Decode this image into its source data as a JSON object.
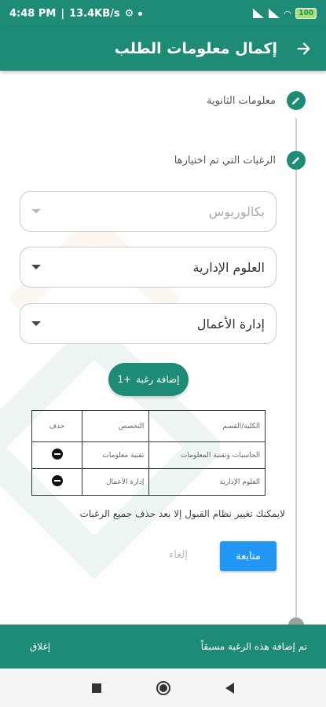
{
  "status_bar": {
    "time": "4:48 PM",
    "speed": "13.4KB/s",
    "battery": "100"
  },
  "app_bar": {
    "title": "إكمال معلومات الطلب",
    "back_icon": "arrow-right-icon"
  },
  "steps": [
    {
      "label": "معلومات الثانوية",
      "icon": "pencil-icon"
    },
    {
      "label": "الرغبات التي تم اختيارها",
      "icon": "pencil-icon"
    }
  ],
  "form": {
    "degree": "بكالوريوس",
    "college": "العلوم الإدارية",
    "major": "إدارة الأعمال",
    "add_button": "إضافة رغبة",
    "add_icon": "+1"
  },
  "table": {
    "headers": [
      "الكلية/القسم",
      "التخصص",
      "حذف"
    ],
    "rows": [
      {
        "college": "الحاسبات وتقنية المعلومات",
        "major": "تقنية معلومات"
      },
      {
        "college": "العلوم الإدارية",
        "major": "إدارة الأعمال"
      }
    ]
  },
  "note": "لايمكنك تغيير نظام القبول إلا بعد حذف جميع الرغبات",
  "actions": {
    "continue": "متابعة",
    "cancel": "إلغاء"
  },
  "snackbar": {
    "message": "تم إضافة هذه الرغبة مسبقاً",
    "action": "إغلاق"
  },
  "colors": {
    "primary": "#1e8b76",
    "continue": "#2196f3"
  }
}
